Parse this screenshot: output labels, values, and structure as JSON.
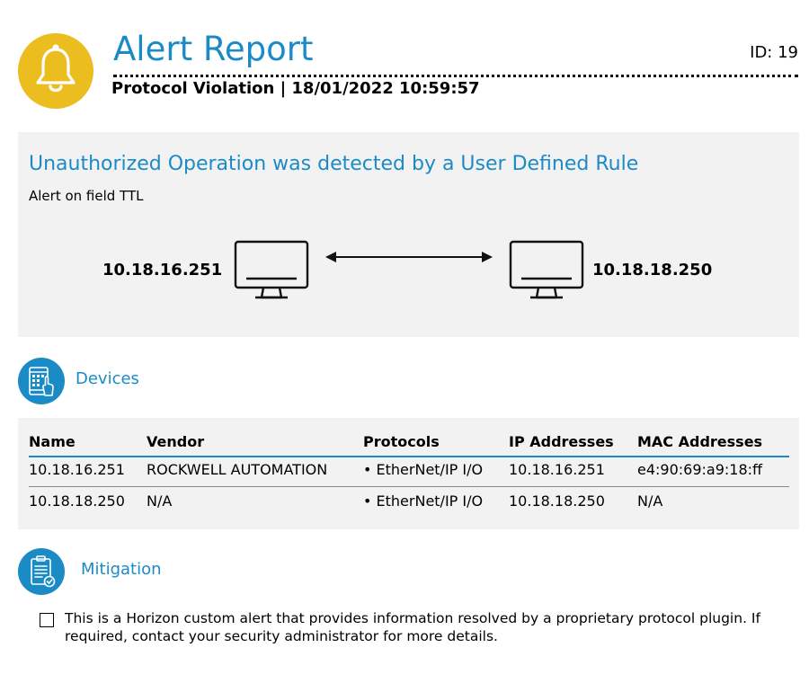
{
  "header": {
    "title": "Alert Report",
    "alert_id": "ID: 19",
    "subtitle": "Protocol Violation | 18/01/2022 10:59:57",
    "icon": "bell-icon",
    "icon_bg": "#ecbd1f"
  },
  "summary": {
    "headline": "Unauthorized Operation was detected by a User Defined Rule",
    "description": "Alert on field TTL",
    "source_ip": "10.18.16.251",
    "destination_ip": "10.18.18.250",
    "link_icon": "double-arrow-icon",
    "device_icon": "monitor-icon"
  },
  "devices": {
    "title": "Devices",
    "icon": "tablet-touch-icon",
    "columns": [
      "Name",
      "Vendor",
      "Protocols",
      "IP Addresses",
      "MAC Addresses"
    ],
    "rows": [
      [
        "10.18.16.251",
        "ROCKWELL AUTOMATION",
        "• EtherNet/IP I/O",
        "10.18.16.251",
        "e4:90:69:a9:18:ff"
      ],
      [
        "10.18.18.250",
        "N/A",
        "• EtherNet/IP I/O",
        "10.18.18.250",
        "N/A"
      ]
    ]
  },
  "mitigation": {
    "title": "Mitigation",
    "icon": "clipboard-check-icon",
    "items": [
      "This is a Horizon custom alert that provides information resolved by a proprietary protocol plugin. If required, contact your security administrator for more details."
    ]
  },
  "colors": {
    "accent": "#1b8bc6",
    "panel": "#f2f2f2",
    "bell": "#ecbd1f"
  }
}
